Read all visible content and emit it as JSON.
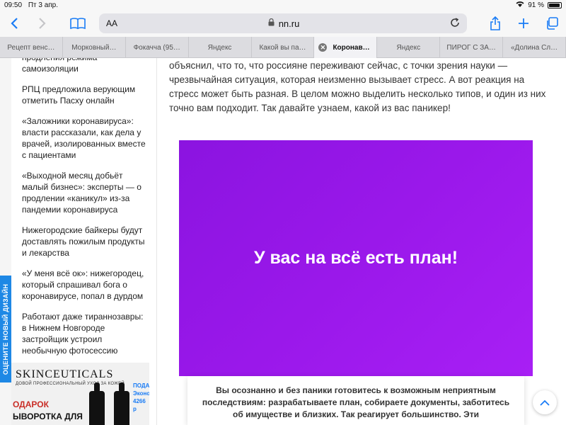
{
  "status": {
    "time": "09:50",
    "date": "Пт 3 апр.",
    "battery": "91 %"
  },
  "toolbar": {
    "back_icon": "chevron-left-icon",
    "forward_icon": "chevron-right-icon",
    "reader_icon": "book-icon",
    "text_size": "AA",
    "url": "nn.ru",
    "reload_icon": "reload-icon",
    "share_icon": "share-icon",
    "new_tab": "+",
    "tabs_icon": "tabs-icon"
  },
  "tabs": [
    {
      "label": "Рецепт венс…"
    },
    {
      "label": "Морковный…"
    },
    {
      "label": "Фокачча (95…"
    },
    {
      "label": "Яндекс"
    },
    {
      "label": "Какой вы па…"
    },
    {
      "label": "Коронав…"
    },
    {
      "label": "Яндекс"
    },
    {
      "label": "ПИРОГ С ЗА…"
    },
    {
      "label": "«Долина Сл…"
    }
  ],
  "sidebar": {
    "news": [
      "продления режима самоизоляции",
      "РПЦ предложила верующим отметить Пасху онлайн",
      "«Заложники коронавируса»: власти рассказали, как дела у врачей, изолированных вместе с пациентами",
      "«Выходной месяц добьёт малый бизнес»: эксперты — о продлении «каникул» из-за пандемии коронавируса",
      "Нижегородские байкеры будут доставлять пожилым продукты и лекарства",
      "«У меня всё ок»: нижегородец, который спрашивал бога о коронавирусе, попал в дурдом",
      "Работают даже тираннозавры: в Нижнем Новгороде застройщик устроил необычную фотосессию"
    ],
    "ad": {
      "brand": "SKINCEUTICALS",
      "subtitle": "ДОВОЙ ПРОФЕССИОНАЛЬНЫЙ УХОД ЗА КОЖЕЙ",
      "gift": "ОДАРОК",
      "product": "ЫВОРОТКА ДЛЯ",
      "side_1": "ПОДА",
      "side_2": "Эконо",
      "side_3": "4266 р"
    }
  },
  "feedback": {
    "label": "ОЦЕНИТЕ НОВЫЙ ДИЗАЙН"
  },
  "article": {
    "intro": "объяснил, что то, что россияне переживают сейчас, с точки зрения науки — чрезвычайная ситуация, которая неизменно вызывает стресс. А вот реакция на стресс может быть разная. В целом можно выделить несколько типов, и один из них точно вам подходит. Так давайте узнаем, какой из вас паникер!",
    "quiz_title": "У вас на всё есть план!",
    "result": "Вы осознанно и без паники готовитесь к возможным неприятным последствиям: разрабатываете план, собираете документы, заботитесь об имуществе и близких. Так реагирует большинство. Эти"
  },
  "scroll": {
    "icon": "chevron-up-icon"
  }
}
